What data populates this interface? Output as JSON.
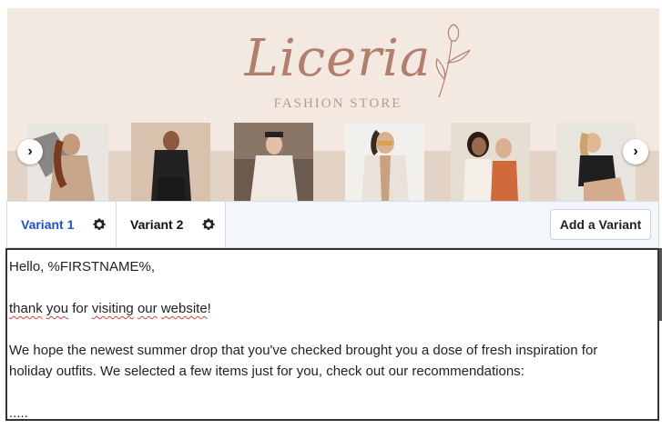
{
  "banner": {
    "logo": "Liceria",
    "subtitle": "FASHION STORE",
    "colors": {
      "background": "#f4e9e1",
      "lower": "#e3d3c4",
      "logo": "#b27f6c"
    }
  },
  "carousel": {
    "prev_icon": "chevron-left-icon",
    "next_icon": "chevron-right-icon",
    "prev": "›",
    "next": "›"
  },
  "tabs": [
    {
      "label": "Variant 1",
      "active": true,
      "icon": "gear-icon"
    },
    {
      "label": "Variant 2",
      "active": false,
      "icon": "gear-icon"
    }
  ],
  "add_variant_label": "Add a Variant",
  "accent_color": "#1d4fd8",
  "editor": {
    "greeting": "Hello, %FIRSTNAME%,",
    "line2_words": [
      "thank",
      "you",
      "for",
      "visiting",
      "our",
      "website",
      "!"
    ],
    "line3": "We hope the newest summer drop that you've checked brought you a dose of fresh inspiration for",
    "line4": "holiday outfits. We selected a few items just for you, check out our recommendations:",
    "line5": "....."
  }
}
